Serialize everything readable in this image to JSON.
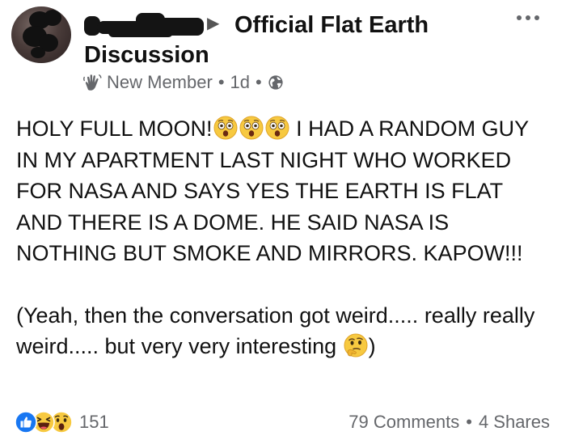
{
  "header": {
    "group_name_line1": "Official Flat Earth",
    "group_name_line2": "Discussion",
    "arrow_glyph": "▶",
    "badge_label": "New Member",
    "separator": "•",
    "time_ago": "1d",
    "privacy_icon": "globe-icon",
    "badge_icon": "wave-hand-icon",
    "more_icon": "more-options-icon"
  },
  "post": {
    "line1_a": "HOLY FULL MOON!",
    "line1_b": " I HAD A RANDOM GUY IN MY APARTMENT LAST NIGHT WHO WORKED FOR NASA AND SAYS YES THE EARTH IS FLAT AND THERE IS A DOME. HE SAID NASA IS NOTHING BUT SMOKE AND MIRRORS. KAPOW!!!",
    "para2_a": "(Yeah, then the conversation got weird..... really really weird..... but very very interesting ",
    "para2_b": ")",
    "emoji_1": "astonished-emoji",
    "emoji_2": "thinking-emoji"
  },
  "footer": {
    "reaction_icons": [
      "like-icon",
      "haha-icon",
      "wow-icon"
    ],
    "reaction_count": "151",
    "comments": "79 Comments",
    "separator": "•",
    "shares": "4 Shares"
  },
  "colors": {
    "text": "#111111",
    "muted": "#65676b",
    "like_blue": "#1877f2",
    "emoji_yellow": "#f7c940"
  }
}
